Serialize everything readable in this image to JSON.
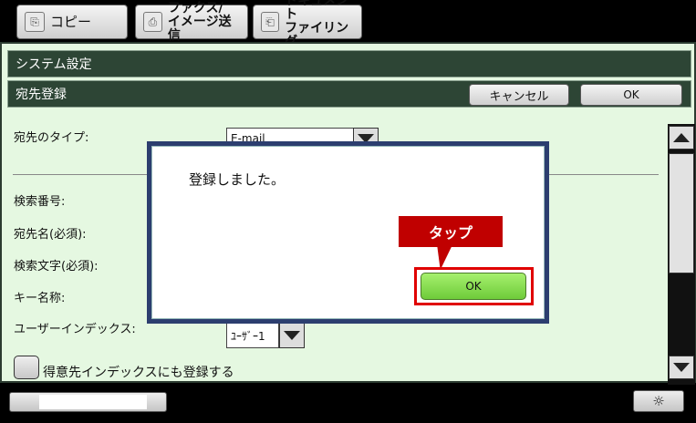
{
  "mode_tabs": {
    "copy": {
      "label": "コピー"
    },
    "fax": {
      "label": "ファクス/\nイメージ送信"
    },
    "filing": {
      "label": "ドキュメント\nファイリング"
    }
  },
  "header": {
    "title": "システム設定",
    "subtitle": "宛先登録",
    "cancel_label": "キャンセル",
    "ok_label": "OK"
  },
  "form": {
    "type_label": "宛先のタイプ:",
    "type_value": "E-mail",
    "search_number_label": "検索番号:",
    "name_label": "宛先名(必須):",
    "search_text_label": "検索文字(必須):",
    "key_name_label": "キー名称:",
    "user_index_label": "ユーザーインデックス:",
    "user_index_value": "ﾕｰｻﾞｰ1",
    "favorite_label": "得意先インデックスにも登録する"
  },
  "dialog": {
    "message": "登録しました。",
    "ok_label": "OK"
  },
  "annotation": {
    "tap_label": "タップ"
  },
  "bottom": {
    "brightness_icon": "☼"
  },
  "colors": {
    "panel_bg": "#e5f8e1",
    "header_bg": "#2d4535",
    "dialog_border": "#2c3e6f",
    "ok_green": "#7fd44a",
    "tap_red": "#c00000"
  }
}
